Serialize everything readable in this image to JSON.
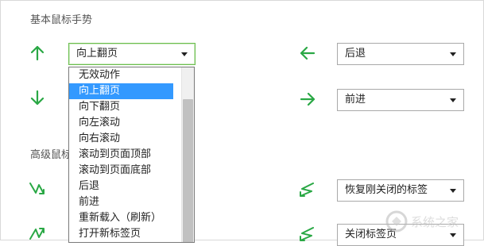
{
  "section_basic": {
    "title": "基本鼠标手势"
  },
  "section_advanced": {
    "title": "高级鼠标"
  },
  "gestures": {
    "up": {
      "icon": "arrow-up-icon",
      "value": "向上翻页"
    },
    "down": {
      "icon": "arrow-down-icon",
      "value": ""
    },
    "left": {
      "icon": "arrow-left-icon",
      "value": "后退"
    },
    "right": {
      "icon": "arrow-right-icon",
      "value": "前进"
    },
    "down_up": {
      "icon": "down-up-gesture-icon"
    },
    "left_right": {
      "icon": "left-right-gesture-icon",
      "value": "恢复刚关闭的标签"
    },
    "up_down": {
      "icon": "up-down-gesture-icon"
    },
    "right_left": {
      "icon": "right-left-gesture-icon",
      "value": "关闭标签页"
    }
  },
  "dropdown": {
    "selected_index": 1,
    "options": [
      "无效动作",
      "向上翻页",
      "向下翻页",
      "向左滚动",
      "向右滚动",
      "滚动到页面顶部",
      "滚动到页面底部",
      "后退",
      "前进",
      "重新载入（刷新）",
      "打开新标签页"
    ]
  },
  "colors": {
    "arrow_green": "#2aa845",
    "focus_border": "#6bbf4e",
    "selection": "#3399ff"
  },
  "watermark": {
    "text": "系统之家"
  }
}
